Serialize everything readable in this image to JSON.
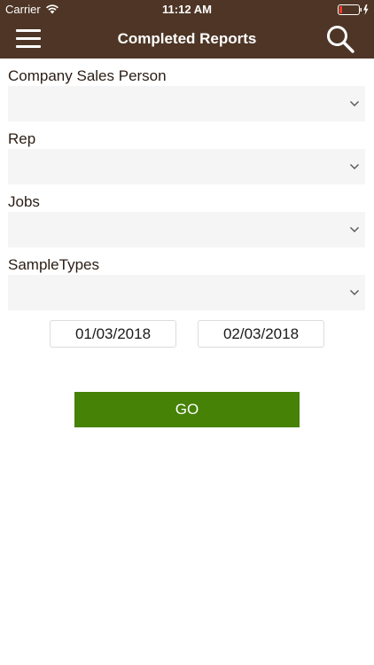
{
  "status_bar": {
    "carrier": "Carrier",
    "time": "11:12 AM",
    "wifi_icon": "wifi-icon",
    "battery_icon": "battery-low-icon"
  },
  "header": {
    "title": "Completed Reports",
    "menu_icon": "hamburger-menu-icon",
    "search_icon": "search-icon",
    "background_color": "#4e3525"
  },
  "filters": [
    {
      "label": "Company Sales Person",
      "value": ""
    },
    {
      "label": "Rep",
      "value": ""
    },
    {
      "label": "Jobs",
      "value": ""
    },
    {
      "label": "SampleTypes",
      "value": ""
    }
  ],
  "dates": {
    "start": "01/03/2018",
    "end": "02/03/2018"
  },
  "go_button": {
    "label": "GO",
    "color": "#458206"
  }
}
